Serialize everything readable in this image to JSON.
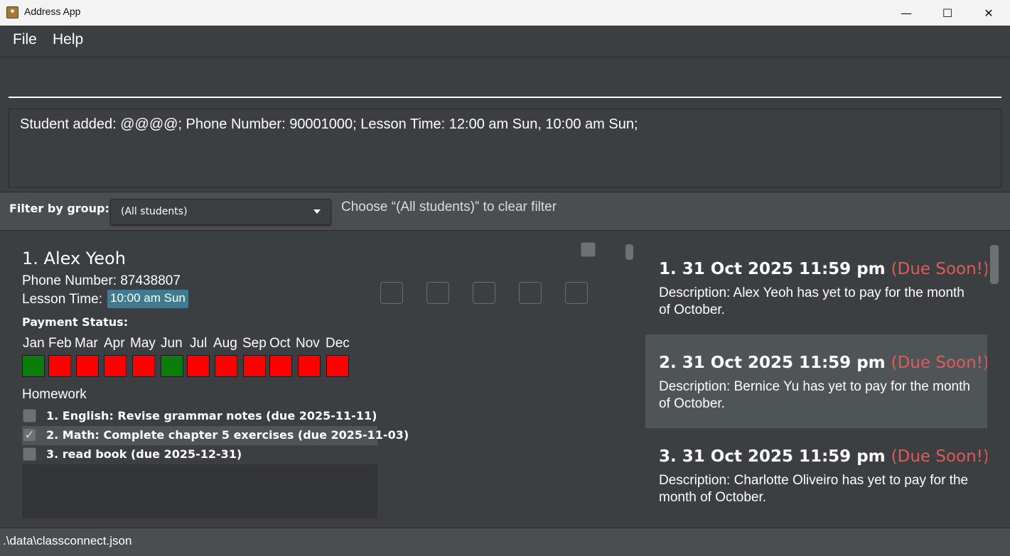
{
  "window": {
    "title": "Address App",
    "minimize_glyph": "—",
    "maximize_glyph": "☐",
    "close_glyph": "✕"
  },
  "menu": {
    "file": "File",
    "help": "Help"
  },
  "command": {
    "value": ""
  },
  "result": {
    "text": "Student added: @@@@; Phone Number: 90001000; Lesson Time: 12:00 am Sun, 10:00 am Sun;"
  },
  "filter": {
    "label": "Filter by group:",
    "selected": "(All students)",
    "hint": "Choose “(All students)” to clear filter"
  },
  "student": {
    "name": "1. Alex Yeoh",
    "phone": "Phone Number: 87438807",
    "lesson_label": "Lesson Time:",
    "lesson_time": "10:00 am Sun",
    "payment_label": "Payment Status:",
    "months": [
      "Jan",
      "Feb",
      "Mar",
      "Apr",
      "May",
      "Jun",
      "Jul",
      "Aug",
      "Sep",
      "Oct",
      "Nov",
      "Dec"
    ],
    "payment_status": [
      "paid",
      "unpaid",
      "unpaid",
      "unpaid",
      "unpaid",
      "paid",
      "unpaid",
      "unpaid",
      "unpaid",
      "unpaid",
      "unpaid",
      "unpaid"
    ],
    "homework_label": "Homework",
    "homework": [
      {
        "text": "1. English: Revise grammar notes (due 2025-11-11)",
        "done": false
      },
      {
        "text": "2. Math: Complete chapter 5 exercises (due 2025-11-03)",
        "done": true
      },
      {
        "text": "3. read book (due 2025-12-31)",
        "done": false
      }
    ]
  },
  "colors": {
    "paid": "#0a7d0a",
    "unpaid": "#ff0000",
    "due": "#e05a5a",
    "lesson_tag": "#3e7b91"
  },
  "reminders": [
    {
      "title": "1. 31 Oct 2025 11:59 pm",
      "due": "(Due Soon!)",
      "desc": "Description: Alex Yeoh has yet to pay for the month of October."
    },
    {
      "title": "2. 31 Oct 2025 11:59 pm",
      "due": "(Due Soon!)",
      "desc": "Description: Bernice Yu has yet to pay for the month of October."
    },
    {
      "title": "3. 31 Oct 2025 11:59 pm",
      "due": "(Due Soon!)",
      "desc": "Description: Charlotte Oliveiro has yet to pay for the month of October."
    }
  ],
  "status": {
    "path": ".\\data\\classconnect.json"
  }
}
